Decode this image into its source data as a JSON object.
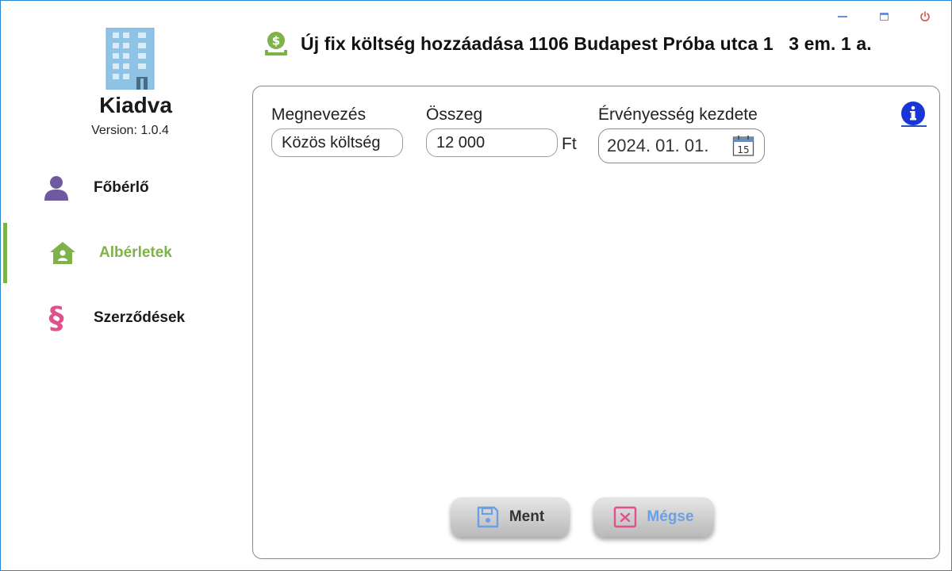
{
  "app": {
    "name": "Kiadva",
    "version": "Version: 1.0.4"
  },
  "window_controls": {
    "minimize_icon": "minimize-icon",
    "maximize_icon": "maximize-icon",
    "power_icon": "power-icon"
  },
  "nav": {
    "items": [
      {
        "label": "Főbérlő",
        "icon": "person-icon",
        "color": "#6f5aa0",
        "active": false
      },
      {
        "label": "Albérletek",
        "icon": "home-icon",
        "color": "#7eb24a",
        "active": true
      },
      {
        "label": "Szerződések",
        "icon": "paragraph-icon",
        "color": "#e0508a",
        "active": false
      }
    ]
  },
  "header": {
    "icon": "money-icon",
    "title": "Új fix költség hozzáadása 1106 Budapest Próba utca 1   3 em. 1 a."
  },
  "form": {
    "name_label": "Megnevezés",
    "name_value": "Közös költség",
    "amount_label": "Összeg",
    "amount_value": "12 000",
    "amount_unit": "Ft",
    "start_label": "Érvényesség kezdete",
    "start_value": "2024. 01. 01.",
    "calendar_day": "15"
  },
  "buttons": {
    "save_label": "Ment",
    "cancel_label": "Mégse"
  },
  "colors": {
    "accent_green": "#7eb24a",
    "info_blue": "#1a35d6",
    "window_border": "#2b86d6"
  }
}
